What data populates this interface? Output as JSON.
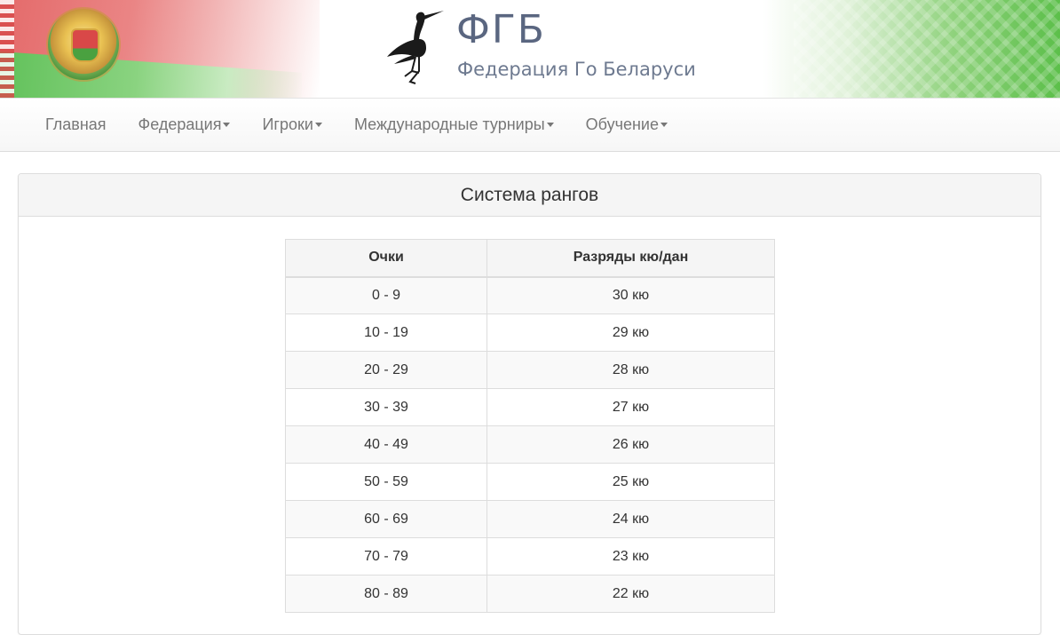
{
  "header": {
    "abbr": "ФГБ",
    "full_name": "Федерация Го Беларуси"
  },
  "nav": {
    "items": [
      {
        "label": "Главная",
        "dropdown": false
      },
      {
        "label": "Федерация",
        "dropdown": true
      },
      {
        "label": "Игроки",
        "dropdown": true
      },
      {
        "label": "Международные турниры",
        "dropdown": true
      },
      {
        "label": "Обучение",
        "dropdown": true
      }
    ]
  },
  "panel": {
    "title": "Система рангов"
  },
  "table": {
    "headers": [
      "Очки",
      "Разряды кю/дан"
    ],
    "rows": [
      [
        "0 - 9",
        "30 кю"
      ],
      [
        "10 - 19",
        "29 кю"
      ],
      [
        "20 - 29",
        "28 кю"
      ],
      [
        "30 - 39",
        "27 кю"
      ],
      [
        "40 - 49",
        "26 кю"
      ],
      [
        "50 - 59",
        "25 кю"
      ],
      [
        "60 - 69",
        "24 кю"
      ],
      [
        "70 - 79",
        "23 кю"
      ],
      [
        "80 - 89",
        "22 кю"
      ]
    ]
  }
}
